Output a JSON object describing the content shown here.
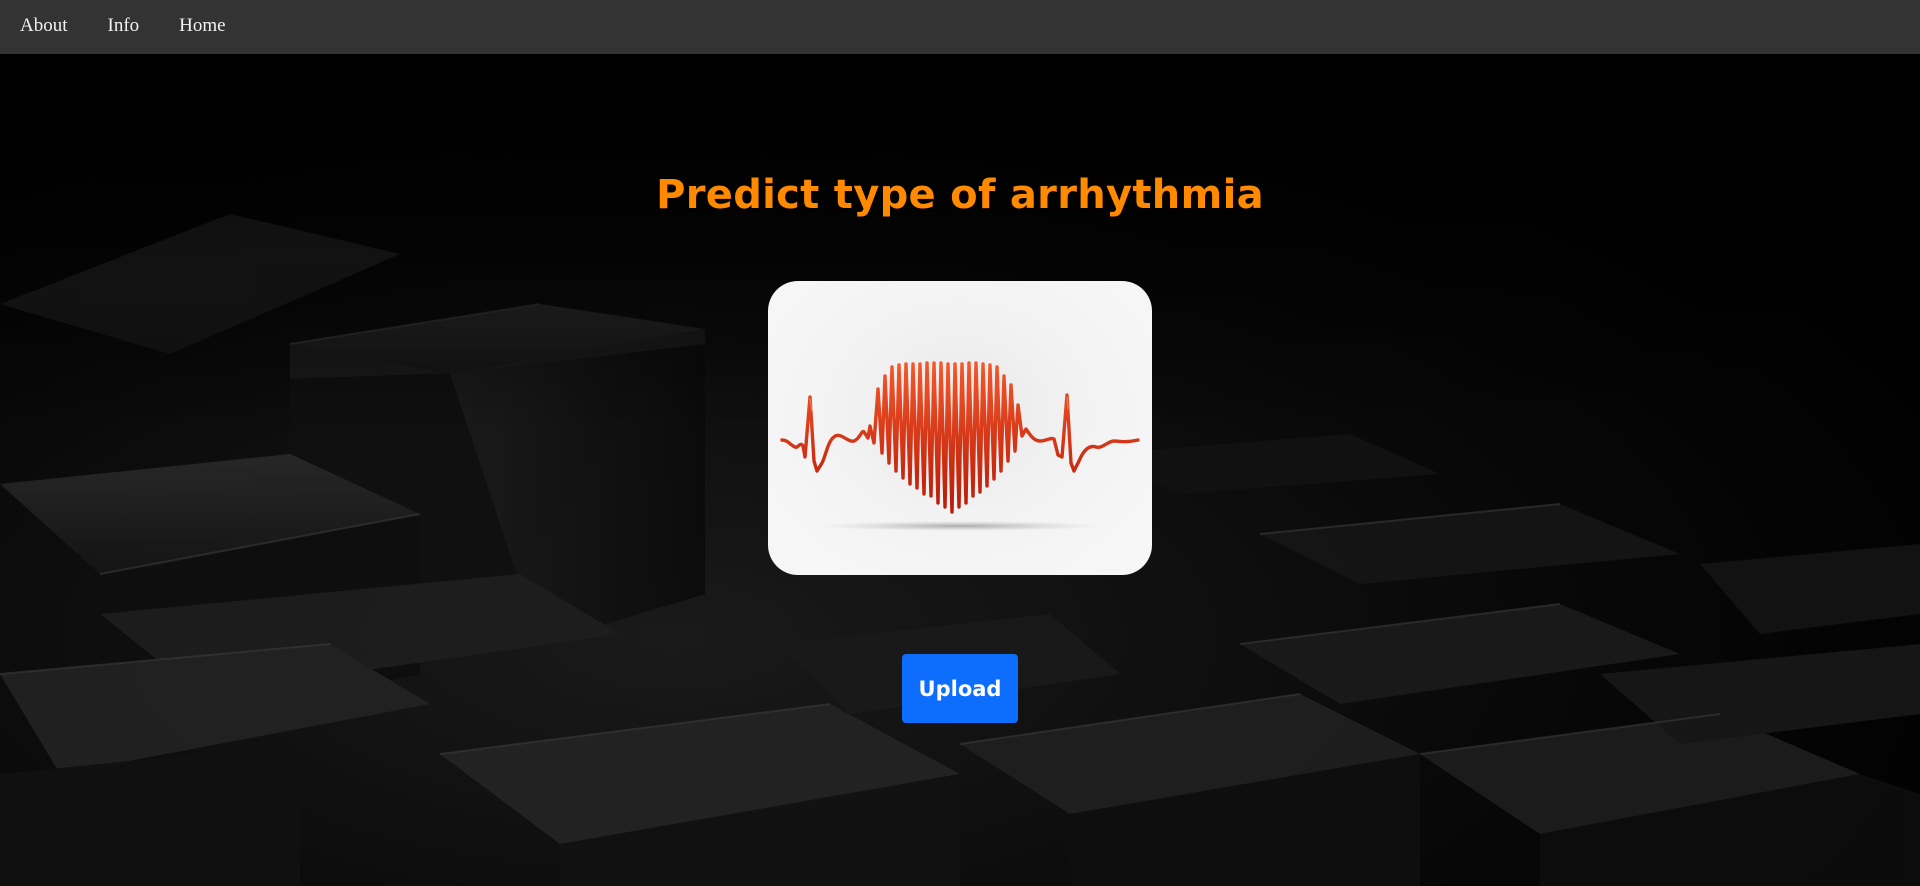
{
  "nav": {
    "items": [
      {
        "label": "About"
      },
      {
        "label": "Info"
      },
      {
        "label": "Home"
      }
    ]
  },
  "main": {
    "title": "Predict type of arrhythmia",
    "image_icon": "heartbeat-heart-icon",
    "upload_label": "Upload"
  },
  "colors": {
    "nav_bg": "#333333",
    "nav_text": "#f2f2f2",
    "title": "#ff8a00",
    "button": "#0d6efd",
    "button_text": "#ffffff",
    "ecg_line": "#d92a0c",
    "background": "#000000"
  }
}
